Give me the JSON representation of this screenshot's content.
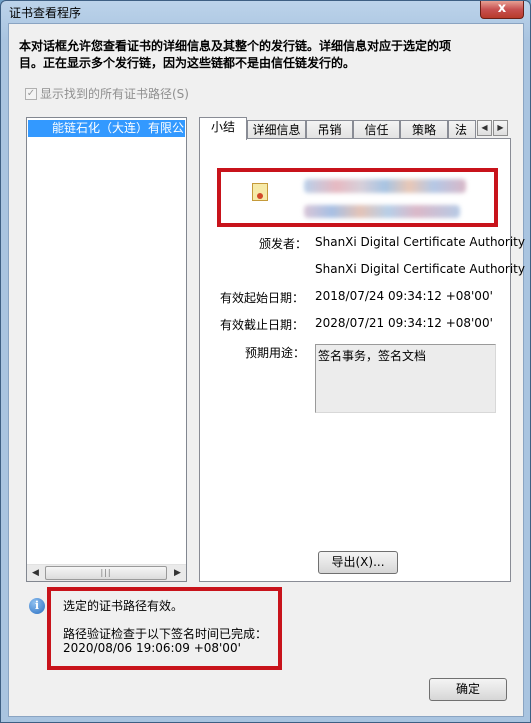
{
  "window": {
    "title": "证书查看程序",
    "close_glyph": "x"
  },
  "intro": {
    "line1": "本对话框允许您查看证书的详细信息及其整个的发行链。详细信息对应于选定的项",
    "line2": "目。正在显示多个发行链，因为这些链都不是由信任链发行的。"
  },
  "show_all_paths": {
    "label": "显示找到的所有证书路径(S)",
    "checked": true,
    "enabled": false
  },
  "tree": {
    "items": [
      {
        "label": "能链石化（大连）有限公",
        "selected": true
      }
    ],
    "scroll_left": "◀",
    "scroll_right": "▶",
    "thumb_grip": "|||"
  },
  "tabs": [
    {
      "label": "小结",
      "active": true
    },
    {
      "label": "详细信息",
      "active": false
    },
    {
      "label": "吊销",
      "active": false
    },
    {
      "label": "信任",
      "active": false
    },
    {
      "label": "策略",
      "active": false
    },
    {
      "label": "法",
      "active": false
    }
  ],
  "tab_scroll": {
    "left": "◀",
    "right": "▶"
  },
  "summary": {
    "issuer_label": "颁发者：",
    "issuer_value": "ShanXi Digital Certificate Authority",
    "issuer_value2": "ShanXi Digital Certificate Authority",
    "valid_from_label": "有效起始日期：",
    "valid_from_value": "2018/07/24 09:34:12 +08'00'",
    "valid_to_label": "有效截止日期：",
    "valid_to_value": "2028/07/21 09:34:12 +08'00'",
    "purpose_label": "预期用途：",
    "purpose_value": "签名事务，签名文档",
    "export_button": "导出(X)..."
  },
  "status": {
    "line1": "选定的证书路径有效。",
    "line2": "路径验证检查于以下签名时间已完成：",
    "line3": "2020/08/06 19:06:09 +08'00'"
  },
  "ok_button": "确定",
  "highlight_color": "#c8131b",
  "selection_color": "#3399ff"
}
